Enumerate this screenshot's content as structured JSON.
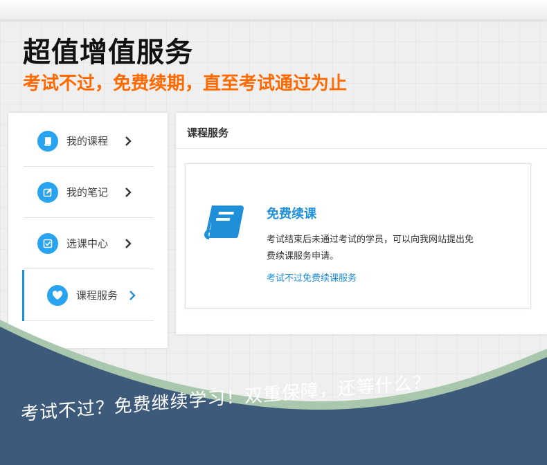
{
  "banner": {
    "headline": "超值增值服务",
    "subhead": "考试不过，免费续期，直至考试通过为止"
  },
  "sidebar": {
    "items": [
      {
        "label": "我的课程",
        "icon": "book-icon",
        "active": false
      },
      {
        "label": "我的笔记",
        "icon": "edit-icon",
        "active": false
      },
      {
        "label": "选课中心",
        "icon": "checkbox-icon",
        "active": false
      },
      {
        "label": "课程服务",
        "icon": "heart-icon",
        "active": true
      }
    ]
  },
  "panel": {
    "title": "课程服务",
    "card": {
      "icon": "book-icon",
      "title": "免费续课",
      "description": "考试结束后未通过考试的学员，可以向我网站提出免费续课服务申请。",
      "link": "考试不过免费续课服务"
    }
  },
  "footer": {
    "slogan": "考试不过？免费继续学习！双重保障，还等什么？"
  },
  "colors": {
    "accent_blue": "#1e8fd8",
    "icon_blue": "#27a3f0",
    "orange": "#ff6a00",
    "footer_navy": "#3e5a7b",
    "wave_green": "#a9c7ac"
  }
}
